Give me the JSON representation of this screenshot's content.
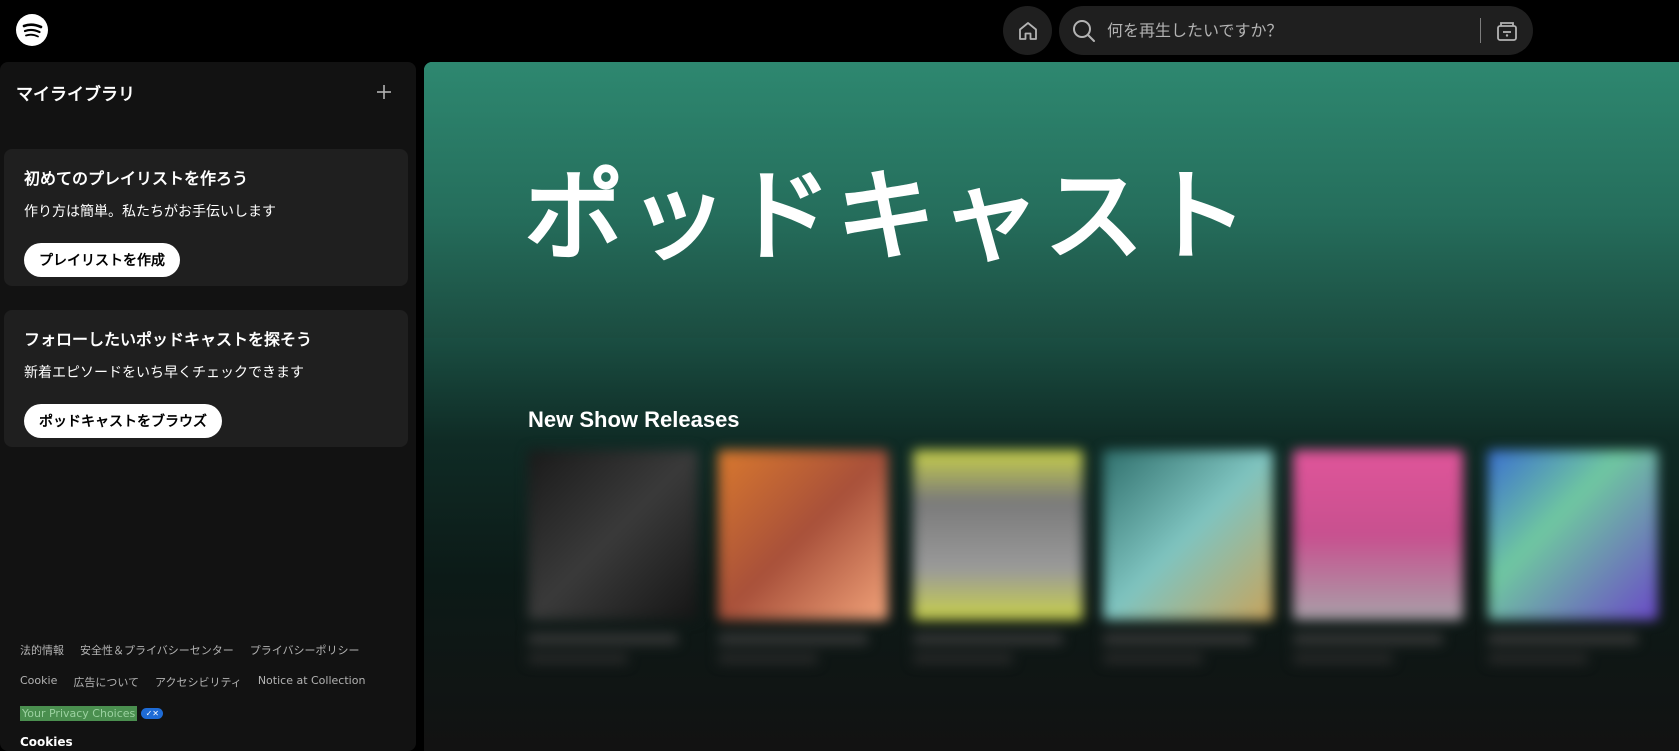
{
  "topbar": {
    "logo_icon": "spotify-logo-icon",
    "home_icon": "home-icon",
    "search_icon": "search-icon",
    "search_placeholder": "何を再生したいですか？",
    "browse_icon": "browse-icon"
  },
  "sidebar": {
    "title": "マイライブラリ",
    "add_icon": "plus-icon",
    "cards": [
      {
        "title": "初めてのプレイリストを作ろう",
        "subtitle": "作り方は簡単。私たちがお手伝いします",
        "button": "プレイリストを作成"
      },
      {
        "title": "フォローしたいポッドキャストを探そう",
        "subtitle": "新着エピソードをいち早くチェックできます",
        "button": "ポッドキャストをブラウズ"
      }
    ],
    "footer": {
      "links_row1": [
        "法的情報",
        "安全性＆プライバシーセンター",
        "プライバシーポリシー"
      ],
      "links_row2": [
        "Cookie",
        "広告について",
        "アクセシビリティ",
        "Notice at Collection"
      ],
      "privacy_choices": "Your Privacy Choices",
      "cookies": "Cookies"
    }
  },
  "main": {
    "hero_title": "ポッドキャスト",
    "section_title": "New Show Releases",
    "show_colors": [
      "#2a2a2a",
      "#d9792e",
      "#c9d14a",
      "#3b8c8a",
      "#c8508f",
      "#3a6fd0"
    ]
  }
}
